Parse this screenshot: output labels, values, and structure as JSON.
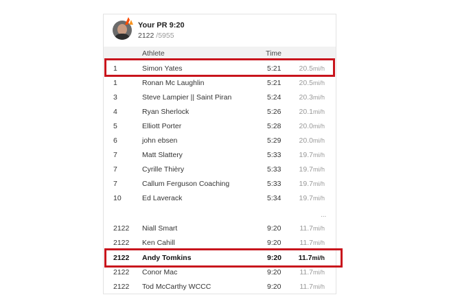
{
  "header": {
    "title": "Your PR 9:20",
    "rank": "2122",
    "total": "/5955"
  },
  "columns": {
    "athlete": "Athlete",
    "time": "Time"
  },
  "top_rows": [
    {
      "rank": "1",
      "name": "Simon Yates",
      "time": "5:21",
      "speed": "20.5",
      "unit": "mi/h"
    },
    {
      "rank": "1",
      "name": "Ronan Mc Laughlin",
      "time": "5:21",
      "speed": "20.5",
      "unit": "mi/h"
    },
    {
      "rank": "3",
      "name": "Steve Lampier || Saint Piran",
      "time": "5:24",
      "speed": "20.3",
      "unit": "mi/h"
    },
    {
      "rank": "4",
      "name": "Ryan Sherlock",
      "time": "5:26",
      "speed": "20.1",
      "unit": "mi/h"
    },
    {
      "rank": "5",
      "name": "Elliott Porter",
      "time": "5:28",
      "speed": "20.0",
      "unit": "mi/h"
    },
    {
      "rank": "6",
      "name": "john ebsen",
      "time": "5:29",
      "speed": "20.0",
      "unit": "mi/h"
    },
    {
      "rank": "7",
      "name": "Matt Slattery",
      "time": "5:33",
      "speed": "19.7",
      "unit": "mi/h"
    },
    {
      "rank": "7",
      "name": "Cyrille Thièry",
      "time": "5:33",
      "speed": "19.7",
      "unit": "mi/h"
    },
    {
      "rank": "7",
      "name": "Callum Ferguson Coaching",
      "time": "5:33",
      "speed": "19.7",
      "unit": "mi/h"
    },
    {
      "rank": "10",
      "name": "Ed Laverack",
      "time": "5:34",
      "speed": "19.7",
      "unit": "mi/h"
    }
  ],
  "ellipsis": "...",
  "bottom_rows": [
    {
      "rank": "2122",
      "name": "Niall Smart",
      "time": "9:20",
      "speed": "11.7",
      "unit": "mi/h"
    },
    {
      "rank": "2122",
      "name": "Ken Cahill",
      "time": "9:20",
      "speed": "11.7",
      "unit": "mi/h"
    },
    {
      "rank": "2122",
      "name": "Andy Tomkins",
      "time": "9:20",
      "speed": "11.7",
      "unit": "mi/h"
    },
    {
      "rank": "2122",
      "name": "Conor Mac",
      "time": "9:20",
      "speed": "11.7",
      "unit": "mi/h"
    },
    {
      "rank": "2122",
      "name": "Tod McCarthy WCCC",
      "time": "9:20",
      "speed": "11.7",
      "unit": "mi/h"
    }
  ],
  "colors": {
    "highlight": "#c8141c",
    "badge": "#fc4c02",
    "header_bg": "#f2f2f2"
  }
}
